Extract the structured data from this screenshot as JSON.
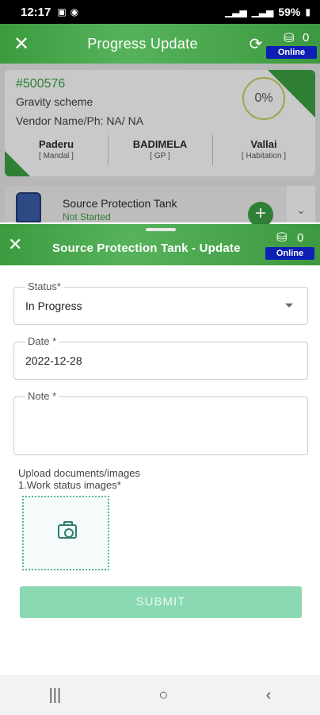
{
  "status_bar": {
    "time": "12:17",
    "battery": "59%"
  },
  "top_header": {
    "title": "Progress Update",
    "sync_count": "0",
    "connection_status": "Online"
  },
  "card": {
    "code": "#500576",
    "scheme": "Gravity scheme",
    "vendor": "Vendor Name/Ph: NA/ NA",
    "progress_text": "0%",
    "locations": [
      {
        "name": "Paderu",
        "type": "[ Mandal ]"
      },
      {
        "name": "BADIMELA",
        "type": "[ GP ]"
      },
      {
        "name": "Vallai",
        "type": "[ Habitation ]"
      }
    ]
  },
  "work_item": {
    "name": "Source Protection Tank",
    "status": "Not Started"
  },
  "sheet": {
    "title": "Source Protection Tank - Update",
    "sync_count": "0",
    "connection_status": "Online",
    "status_field": {
      "label": "Status*",
      "value": "In Progress"
    },
    "date_field": {
      "label": "Date *",
      "value": "2022-12-28"
    },
    "note_field": {
      "label": "Note *",
      "value": ""
    },
    "upload_title": "Upload documents/images",
    "upload_subtitle": "1.Work status images*",
    "submit_label": "SUBMIT"
  },
  "colors": {
    "header_green": "#4caf50",
    "accent_green": "#2f7f35",
    "online_badge": "#0d1fb5",
    "submit_disabled": "#8ad9b2"
  }
}
